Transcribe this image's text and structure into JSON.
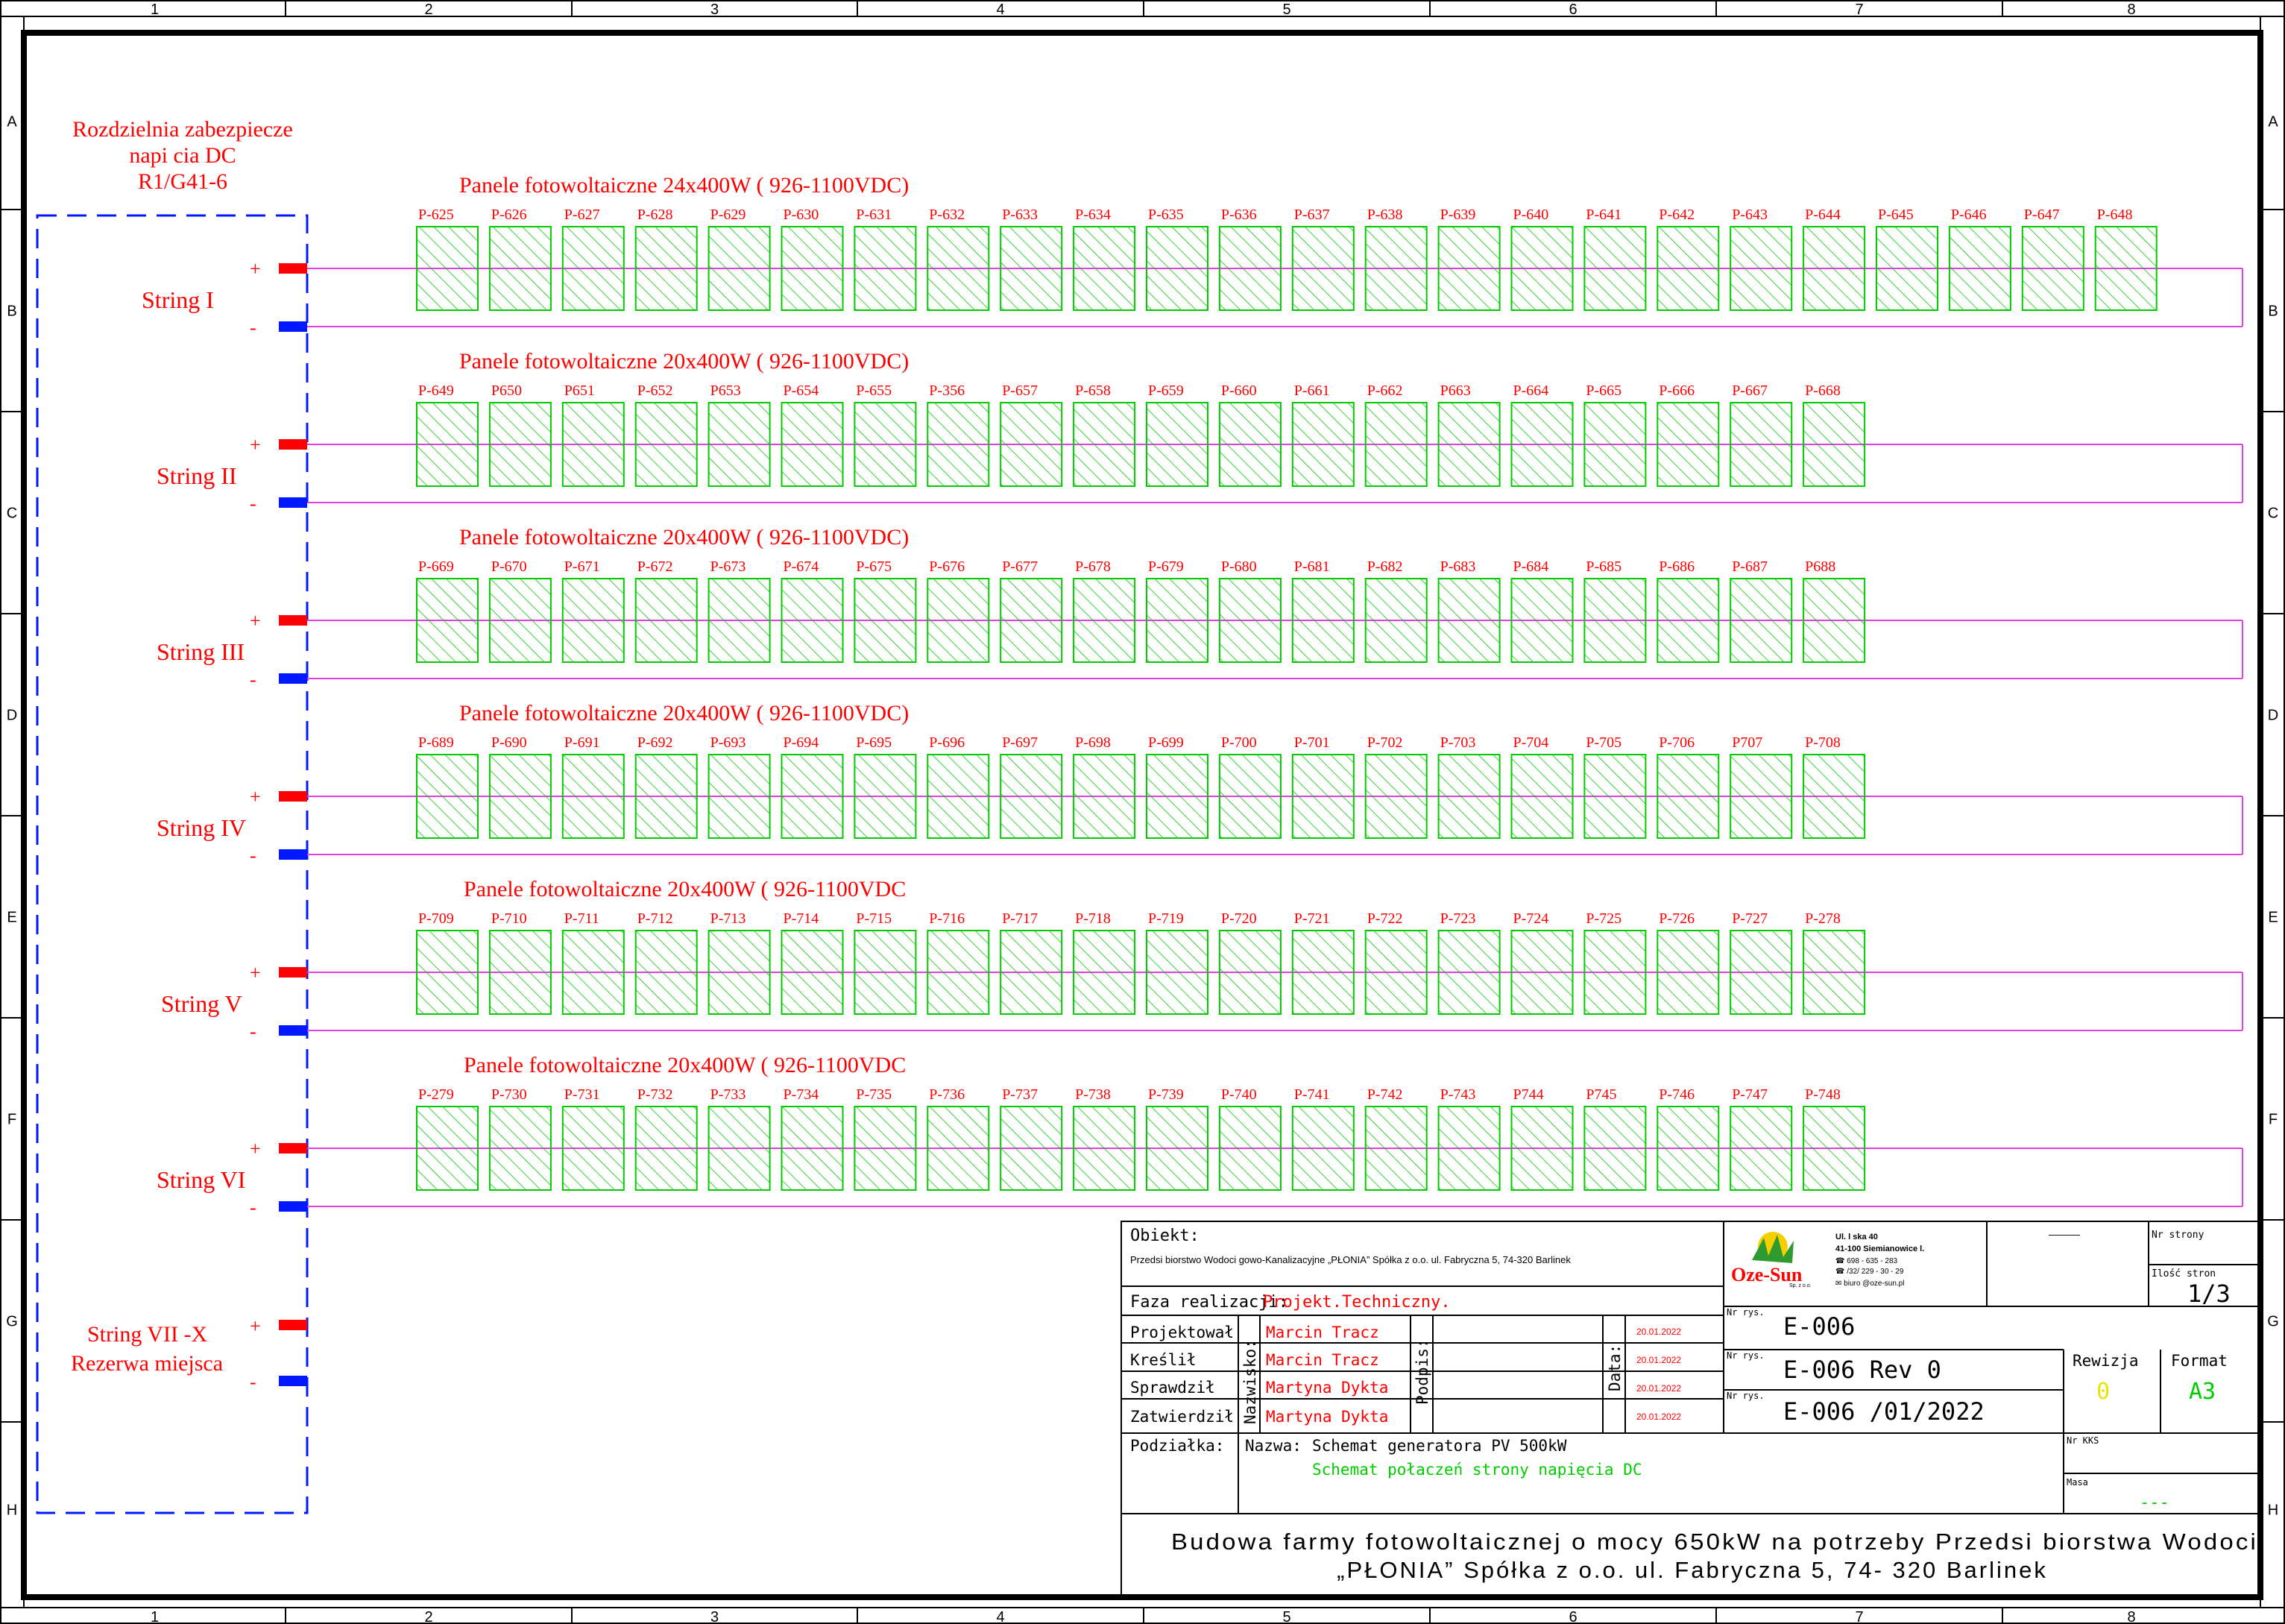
{
  "frame": {
    "col_labels": [
      "1",
      "2",
      "3",
      "4",
      "5",
      "6",
      "7",
      "8"
    ],
    "row_labels": [
      "A",
      "B",
      "C",
      "D",
      "E",
      "F",
      "G",
      "H"
    ]
  },
  "switchboard": {
    "line1": "Rozdzielnia zabezpiecze",
    "line2": "napi  cia DC",
    "line3": "R1/G41-6"
  },
  "polarity": {
    "plus": "+",
    "minus": "-"
  },
  "strings": [
    {
      "name": "String I",
      "title": "Panele fotowoltaiczne 24x400W ( 926-1100VDC)",
      "panels": [
        "P-625",
        "P-626",
        "P-627",
        "P-628",
        "P-629",
        "P-630",
        "P-631",
        "P-632",
        "P-633",
        "P-634",
        "P-635",
        "P-636",
        "P-637",
        "P-638",
        "P-639",
        "P-640",
        "P-641",
        "P-642",
        "P-643",
        "P-644",
        "P-645",
        "P-646",
        "P-647",
        "P-648"
      ]
    },
    {
      "name": "String II",
      "title": "Panele fotowoltaiczne 20x400W ( 926-1100VDC)",
      "panels": [
        "P-649",
        "P650",
        "P651",
        "P-652",
        "P653",
        "P-654",
        "P-655",
        "P-356",
        "P-657",
        "P-658",
        "P-659",
        "P-660",
        "P-661",
        "P-662",
        "P663",
        "P-664",
        "P-665",
        "P-666",
        "P-667",
        "P-668"
      ]
    },
    {
      "name": "String III",
      "title": "Panele fotowoltaiczne 20x400W ( 926-1100VDC)",
      "panels": [
        "P-669",
        "P-670",
        "P-671",
        "P-672",
        "P-673",
        "P-674",
        "P-675",
        "P-676",
        "P-677",
        "P-678",
        "P-679",
        "P-680",
        "P-681",
        "P-682",
        "P-683",
        "P-684",
        "P-685",
        "P-686",
        "P-687",
        "P688"
      ]
    },
    {
      "name": "String IV",
      "title": "Panele fotowoltaiczne 20x400W ( 926-1100VDC)",
      "panels": [
        "P-689",
        "P-690",
        "P-691",
        "P-692",
        "P-693",
        "P-694",
        "P-695",
        "P-696",
        "P-697",
        "P-698",
        "P-699",
        "P-700",
        "P-701",
        "P-702",
        "P-703",
        "P-704",
        "P-705",
        "P-706",
        "P707",
        "P-708"
      ]
    },
    {
      "name": "String V",
      "title": "Panele fotowoltaiczne 20x400W ( 926-1100VDC",
      "panels": [
        "P-709",
        "P-710",
        "P-711",
        "P-712",
        "P-713",
        "P-714",
        "P-715",
        "P-716",
        "P-717",
        "P-718",
        "P-719",
        "P-720",
        "P-721",
        "P-722",
        "P-723",
        "P-724",
        "P-725",
        "P-726",
        "P-727",
        "P-278"
      ]
    },
    {
      "name": "String VI",
      "title": "Panele fotowoltaiczne 20x400W ( 926-1100VDC",
      "panels": [
        "P-279",
        "P-730",
        "P-731",
        "P-732",
        "P-733",
        "P-734",
        "P-735",
        "P-736",
        "P-737",
        "P-738",
        "P-739",
        "P-740",
        "P-741",
        "P-742",
        "P-743",
        "P744",
        "P745",
        "P-746",
        "P-747",
        "P-748"
      ]
    }
  ],
  "reserve": {
    "line1": "String VII -X",
    "line2": "Rezerwa miejsca"
  },
  "title_block": {
    "obiekt_label": "Obiekt:",
    "obiekt_value": "Przedsi  biorstwo Wodoci  gowo-Kanalizacyjne „PŁONIA” Spółka z o.o. ul. Fabryczna 5, 74-320 Barlinek",
    "faza_label": "Faza realizacji:",
    "faza_value": "Projekt.Techniczny.",
    "company": {
      "name": "Oze-Sun",
      "sub": "Sp. z o.o.",
      "addr1": "Ul.   l  ska 40",
      "addr2": "41-100 Siemianowice   l.",
      "phone1": "☎ 698 - 635 - 283",
      "phone2": "☎ /32/ 229 - 30 - 29",
      "email": "✉ biuro @oze-sun.pl"
    },
    "dash_top": "———",
    "nr_strony_label": "Nr strony",
    "ilosc_stron_label": "Ilość stron",
    "ilosc_stron_value": "1/3",
    "roles": [
      "Projektował",
      "Kreślił",
      "Sprawdził",
      "Zatwierdził"
    ],
    "nazwisko_label": "Nazwisko:",
    "people": [
      "Marcin Tracz",
      "Marcin Tracz",
      "Martyna Dykta",
      "Martyna Dykta"
    ],
    "podpis_label": "Podpis:",
    "data_label": "Data:",
    "dates": [
      "20.01.2022",
      "20.01.2022",
      "20.01.2022",
      "20.01.2022"
    ],
    "nr_rys_label": "Nr rys.",
    "nr_rys_values": [
      "E-006",
      "E-006 Rev 0",
      "E-006  /01/2022"
    ],
    "rewizja_label": "Rewizja",
    "rewizja_value": "0",
    "format_label": "Format",
    "format_value": "A3",
    "nr_kks_label": "Nr KKS",
    "masa_label": "Masa",
    "masa_value": "---",
    "podzialka_label": "Podziałka:",
    "nazwa_label": "Nazwa:",
    "nazwa_line1": "Schemat generatora PV 500kW",
    "nazwa_line2": "Schemat połaczeń strony napięcia DC",
    "bottom_line1": "Budowa farmy fotowoltaicznej o mocy 650kW na potrzeby Przedsi biorstwa Wodoci",
    "bottom_line2": "„PŁONIA” Spółka z o.o. ul. Fabryczna 5, 74- 320 Barlinek"
  },
  "colors": {
    "panel": "#00cc00",
    "wire": "#e040e0",
    "plus_terminal": "#ff0000",
    "minus_terminal": "#0018ff",
    "dashed_box": "#0018ff",
    "text_red": "#ff0000"
  }
}
